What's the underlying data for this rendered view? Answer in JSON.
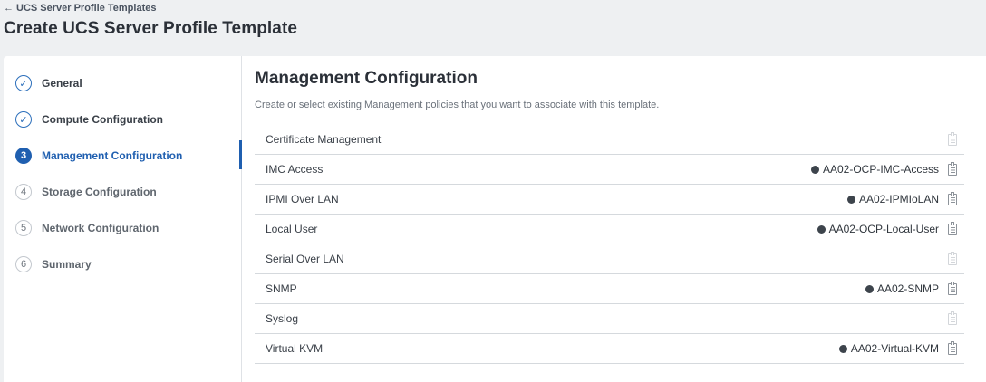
{
  "breadcrumb": {
    "back_label": "UCS Server Profile Templates",
    "back_arrow": "←"
  },
  "page_title": "Create UCS Server Profile Template",
  "steps": [
    {
      "marker": "✓",
      "label": "General",
      "state": "done"
    },
    {
      "marker": "✓",
      "label": "Compute Configuration",
      "state": "done"
    },
    {
      "marker": "3",
      "label": "Management Configuration",
      "state": "active"
    },
    {
      "marker": "4",
      "label": "Storage Configuration",
      "state": "pending"
    },
    {
      "marker": "5",
      "label": "Network Configuration",
      "state": "pending"
    },
    {
      "marker": "6",
      "label": "Summary",
      "state": "pending"
    }
  ],
  "section": {
    "title": "Management Configuration",
    "description": "Create or select existing Management policies that you want to associate with this template."
  },
  "policies": [
    {
      "name": "Certificate Management",
      "value": ""
    },
    {
      "name": "IMC Access",
      "value": "AA02-OCP-IMC-Access"
    },
    {
      "name": "IPMI Over LAN",
      "value": "AA02-IPMIoLAN"
    },
    {
      "name": "Local User",
      "value": "AA02-OCP-Local-User"
    },
    {
      "name": "Serial Over LAN",
      "value": ""
    },
    {
      "name": "SNMP",
      "value": "AA02-SNMP"
    },
    {
      "name": "Syslog",
      "value": ""
    },
    {
      "name": "Virtual KVM",
      "value": "AA02-Virtual-KVM"
    }
  ],
  "icons": {
    "policy_select": "document-icon",
    "policy_set": "check-circle-icon",
    "step_done": "check-circle-icon"
  },
  "colors": {
    "accent": "#1f5fb0",
    "page_bg": "#eef0f2",
    "panel_bg": "#ffffff"
  }
}
